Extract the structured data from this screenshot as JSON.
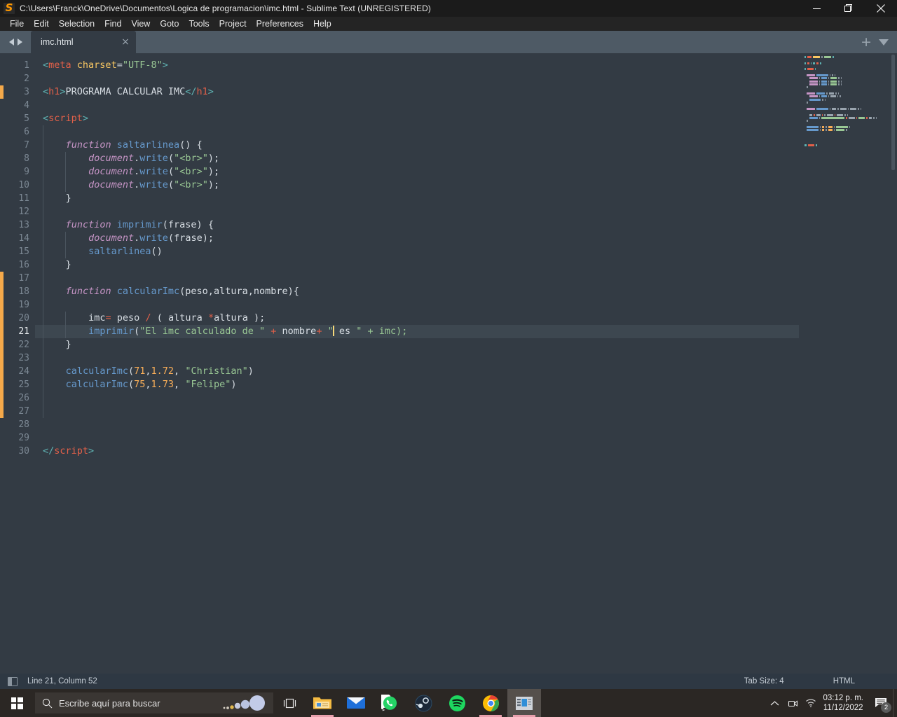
{
  "window": {
    "title": "C:\\Users\\Franck\\OneDrive\\Documentos\\Logica de programacion\\imc.html - Sublime Text (UNREGISTERED)",
    "app_icon": "sublime-text-logo",
    "minimize_label": "—",
    "maximize_label": "❐",
    "close_label": "✕"
  },
  "menubar": {
    "items": [
      {
        "label": "File"
      },
      {
        "label": "Edit"
      },
      {
        "label": "Selection"
      },
      {
        "label": "Find"
      },
      {
        "label": "View"
      },
      {
        "label": "Goto"
      },
      {
        "label": "Tools"
      },
      {
        "label": "Project"
      },
      {
        "label": "Preferences"
      },
      {
        "label": "Help"
      }
    ]
  },
  "tabbar": {
    "tabs": [
      {
        "label": "imc.html",
        "close": "×",
        "active": true
      }
    ],
    "add_label": "+",
    "menu_icon": "chevron-down-icon",
    "nav_prev_icon": "arrow-left-icon",
    "nav_next_icon": "arrow-right-icon"
  },
  "editor": {
    "total_lines": 30,
    "active_line": 21,
    "modified_markers": [
      {
        "from": 3,
        "to": 3
      },
      {
        "from": 17,
        "to": 27
      }
    ],
    "lines": [
      {
        "n": 1,
        "text": "<meta charset=\"UTF-8\">"
      },
      {
        "n": 2,
        "text": ""
      },
      {
        "n": 3,
        "text": "<h1>PROGRAMA CALCULAR IMC</h1>"
      },
      {
        "n": 4,
        "text": ""
      },
      {
        "n": 5,
        "text": "<script>"
      },
      {
        "n": 6,
        "text": ""
      },
      {
        "n": 7,
        "text": "    function saltarlinea() {"
      },
      {
        "n": 8,
        "text": "        document.write(\"<br>\");"
      },
      {
        "n": 9,
        "text": "        document.write(\"<br>\");"
      },
      {
        "n": 10,
        "text": "        document.write(\"<br>\");"
      },
      {
        "n": 11,
        "text": "    }"
      },
      {
        "n": 12,
        "text": ""
      },
      {
        "n": 13,
        "text": "    function imprimir(frase) {"
      },
      {
        "n": 14,
        "text": "        document.write(frase);"
      },
      {
        "n": 15,
        "text": "        saltarlinea()"
      },
      {
        "n": 16,
        "text": "    }"
      },
      {
        "n": 17,
        "text": ""
      },
      {
        "n": 18,
        "text": "    function calcularImc(peso,altura,nombre){"
      },
      {
        "n": 19,
        "text": ""
      },
      {
        "n": 20,
        "text": "        imc= peso / ( altura *altura );"
      },
      {
        "n": 21,
        "text": "        imprimir(\"El imc calculado de \" + nombre+ \" es \" + imc);"
      },
      {
        "n": 22,
        "text": "    }"
      },
      {
        "n": 23,
        "text": ""
      },
      {
        "n": 24,
        "text": "    calcularImc(71,1.72, \"Christian\")"
      },
      {
        "n": 25,
        "text": "    calcularImc(75,1.73, \"Felipe\")"
      },
      {
        "n": 26,
        "text": ""
      },
      {
        "n": 27,
        "text": ""
      },
      {
        "n": 28,
        "text": ""
      },
      {
        "n": 29,
        "text": ""
      },
      {
        "n": 30,
        "text": "</script>"
      }
    ]
  },
  "statusbar": {
    "sidebar_toggle_icon": "sidebar-toggle-icon",
    "position": "Line 21, Column 52",
    "tab_size": "Tab Size: 4",
    "language": "HTML"
  },
  "taskbar": {
    "start_icon": "windows-logo-icon",
    "search": {
      "icon": "search-icon",
      "placeholder": "Escribe aquí para buscar",
      "cortana_icon": "cortana-icon"
    },
    "taskview_icon": "task-view-icon",
    "apps": [
      {
        "name": "file-explorer",
        "label": "Explorador de archivos",
        "active": false,
        "running": true
      },
      {
        "name": "mail",
        "label": "Correo",
        "active": false,
        "running": false
      },
      {
        "name": "whatsapp",
        "label": "WhatsApp",
        "active": false,
        "running": false
      },
      {
        "name": "steam",
        "label": "Steam",
        "active": false,
        "running": false
      },
      {
        "name": "spotify",
        "label": "Spotify",
        "active": false,
        "running": false
      },
      {
        "name": "chrome",
        "label": "Google Chrome",
        "active": false,
        "running": true
      },
      {
        "name": "sublime-text",
        "label": "Sublime Text",
        "active": true,
        "running": true
      }
    ],
    "tray": {
      "overflow_icon": "chevron-up-icon",
      "devices_icon": "camera-icon",
      "network_icon": "wifi-icon",
      "time": "03:12 p. m.",
      "date": "11/12/2022",
      "notifications_icon": "notification-icon",
      "notification_count": "2"
    }
  },
  "colors": {
    "editor_bg": "#333b44",
    "tabbar_bg": "#4e5a65",
    "accent_orange": "#f5a94a",
    "string_green": "#99c794",
    "tag_red": "#e36049",
    "function_blue": "#6699cc",
    "keyword_purple": "#c695c6",
    "number_orange": "#f9ae58"
  }
}
